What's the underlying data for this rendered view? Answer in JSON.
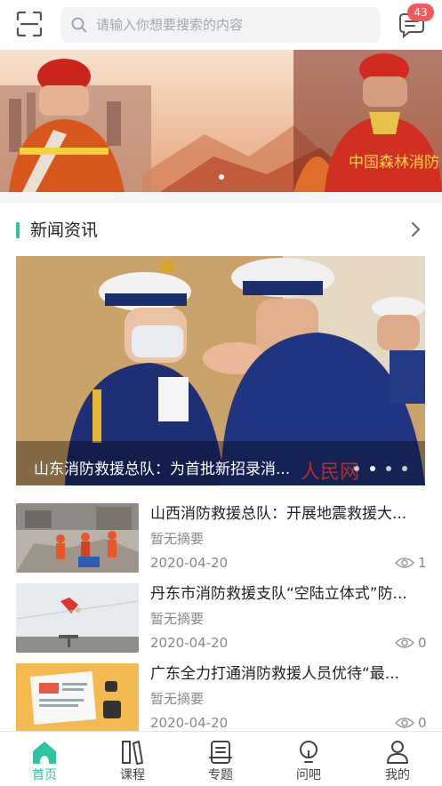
{
  "search": {
    "placeholder": "请输入你想要搜索的内容"
  },
  "messages": {
    "badge_count": "43"
  },
  "banner": {
    "slide_count": 1,
    "active_slide": 1,
    "image_text": "中国森林消防"
  },
  "section": {
    "title": "新闻资讯"
  },
  "hero": {
    "title": "山东消防救援总队：为首批新招录消...",
    "watermark": "人民网",
    "dot_count": 4,
    "active_dot": 2
  },
  "news": [
    {
      "title": "山西消防救援总队：开展地震救援大...",
      "summary": "暂无摘要",
      "date": "2020-04-20",
      "views": "1"
    },
    {
      "title": "丹东市消防救援支队“空陆立体式”防...",
      "summary": "暂无摘要",
      "date": "2020-04-20",
      "views": "0"
    },
    {
      "title": "广东全力打通消防救援人员优待“最...",
      "summary": "暂无摘要",
      "date": "2020-04-20",
      "views": "0"
    }
  ],
  "tabs": [
    {
      "label": "首页",
      "icon": "home-icon",
      "active": true
    },
    {
      "label": "课程",
      "icon": "course-icon",
      "active": false
    },
    {
      "label": "专题",
      "icon": "topic-icon",
      "active": false
    },
    {
      "label": "问吧",
      "icon": "question-icon",
      "active": false
    },
    {
      "label": "我的",
      "icon": "profile-icon",
      "active": false
    }
  ],
  "colors": {
    "accent": "#2ec4a1",
    "badge": "#f05a5a",
    "text": "#222222",
    "muted": "#888888"
  }
}
